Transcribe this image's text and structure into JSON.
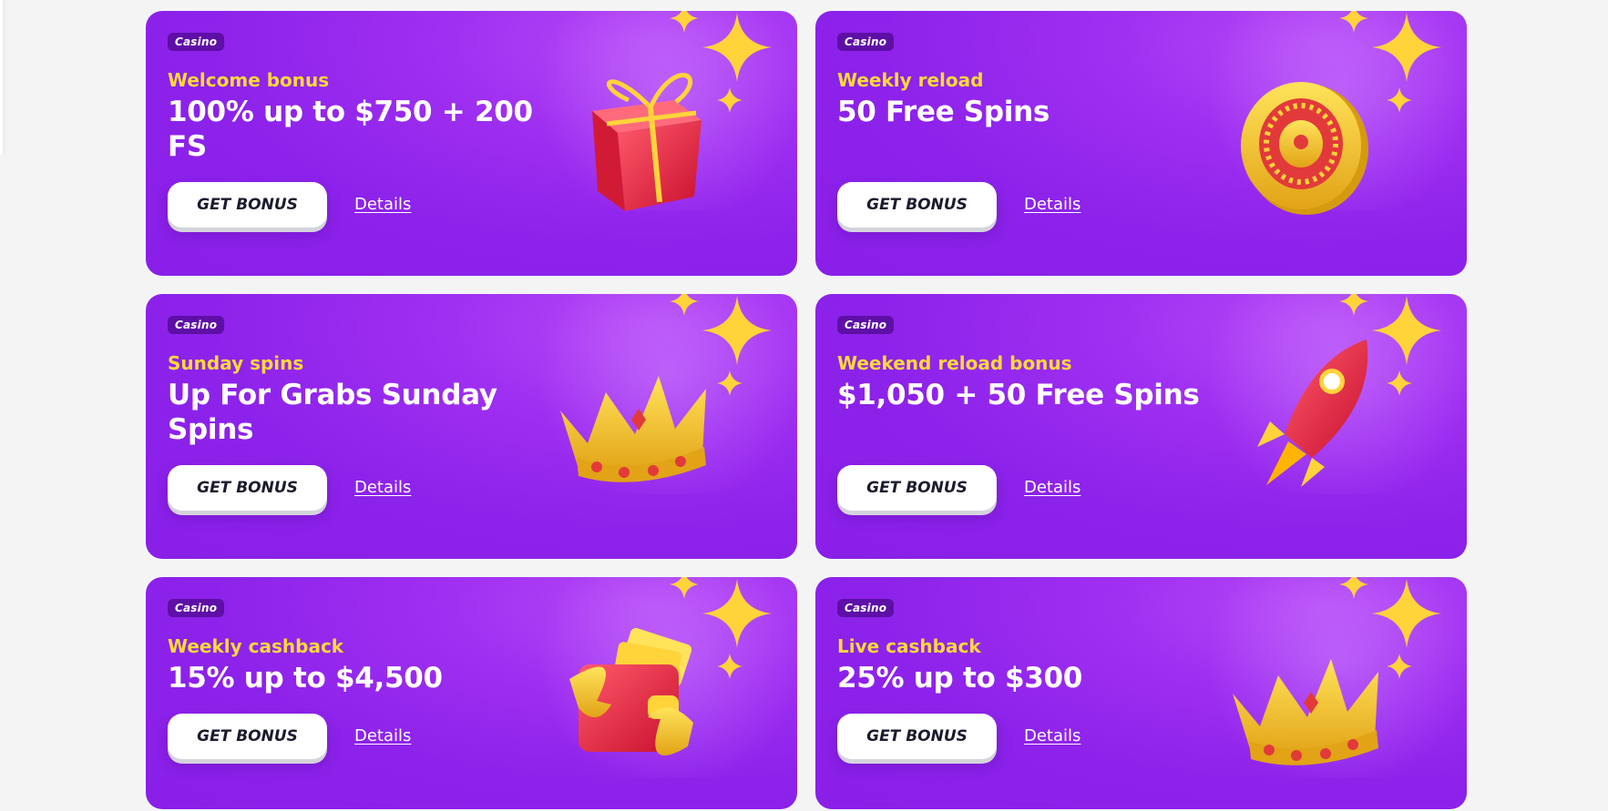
{
  "cards": [
    {
      "tag": "Casino",
      "subtitle": "Welcome bonus",
      "title": "100% up to $750 + 200 FS",
      "button": "GET BONUS",
      "details": "Details",
      "image": "gift-box-icon"
    },
    {
      "tag": "Casino",
      "subtitle": "Weekly reload",
      "title": "50 Free Spins",
      "button": "GET BONUS",
      "details": "Details",
      "image": "roulette-coin-icon"
    },
    {
      "tag": "Casino",
      "subtitle": "Sunday spins",
      "title": "Up For Grabs Sunday Spins",
      "button": "GET BONUS",
      "details": "Details",
      "image": "crown-icon"
    },
    {
      "tag": "Casino",
      "subtitle": "Weekend reload bonus",
      "title": "$1,050 + 50 Free Spins",
      "button": "GET BONUS",
      "details": "Details",
      "image": "rocket-icon"
    },
    {
      "tag": "Casino",
      "subtitle": "Weekly cashback",
      "title": "15% up to $4,500",
      "button": "GET BONUS",
      "details": "Details",
      "image": "wallet-cashback-icon"
    },
    {
      "tag": "Casino",
      "subtitle": "Live cashback",
      "title": "25% up to $300",
      "button": "GET BONUS",
      "details": "Details",
      "image": "crown-icon"
    }
  ],
  "colors": {
    "card_background": "#8d22ea",
    "subtitle": "#ffd93a",
    "tag_background": "#5e0fa6",
    "button_background": "#ffffff"
  }
}
